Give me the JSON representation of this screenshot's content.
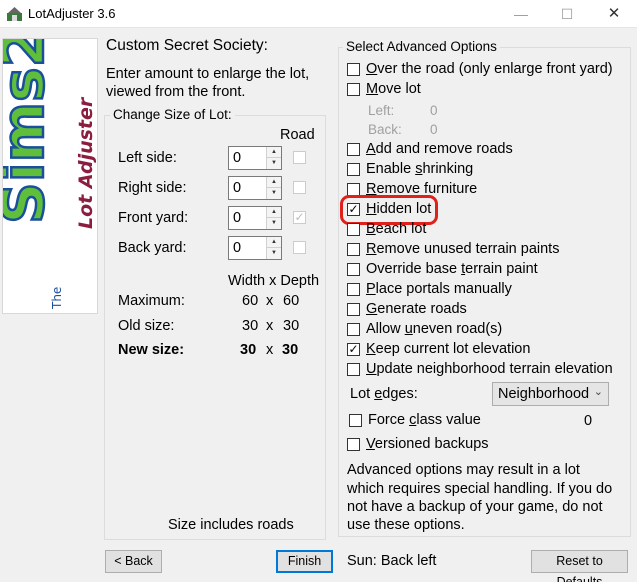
{
  "window": {
    "title": "LotAdjuster 3.6",
    "minimize": "—",
    "maximize": "☐",
    "close": "✕"
  },
  "logo": {
    "game": "The Sims 2",
    "product": "Lot Adjuster"
  },
  "lot": {
    "name": "Custom Secret Society:",
    "instructions_line1": "Enter amount to enlarge the lot,",
    "instructions_line2": "viewed from the front."
  },
  "size_group": {
    "title": "Change Size of Lot:",
    "road_header": "Road",
    "rows": [
      {
        "label": "Left side:",
        "value": "0",
        "road": false,
        "road_glyph": ""
      },
      {
        "label": "Right side:",
        "value": "0",
        "road": false,
        "road_glyph": ""
      },
      {
        "label": "Front yard:",
        "value": "0",
        "road": true,
        "road_glyph": "✓"
      },
      {
        "label": "Back yard:",
        "value": "0",
        "road": false,
        "road_glyph": ""
      }
    ],
    "dims_header": "Width x Depth",
    "x": "x",
    "maximum": {
      "label": "Maximum:",
      "w": "60",
      "d": "60"
    },
    "old_size": {
      "label": "Old size:",
      "w": "30",
      "d": "30"
    },
    "new_size": {
      "label": "New size:",
      "w": "30",
      "d": "30"
    },
    "note": "Size includes roads"
  },
  "advanced": {
    "title": "Select Advanced Options",
    "options": [
      {
        "u": "O",
        "rest": "ver the road (only enlarge front yard)",
        "checked": false,
        "glyph": ""
      },
      {
        "u": "M",
        "rest": "ove lot",
        "checked": false,
        "glyph": ""
      },
      {
        "u": "A",
        "rest": "dd and remove roads",
        "checked": false,
        "glyph": ""
      },
      {
        "pre": "Enable ",
        "u": "s",
        "rest": "hrinking",
        "checked": false,
        "glyph": ""
      },
      {
        "u": "R",
        "rest": "emove furniture",
        "checked": false,
        "glyph": ""
      },
      {
        "u": "H",
        "rest": "idden lot",
        "checked": true,
        "glyph": "✓"
      },
      {
        "u": "B",
        "rest": "each lot",
        "checked": false,
        "glyph": ""
      },
      {
        "u": "R",
        "rest": "emove unused terrain paints",
        "checked": false,
        "glyph": ""
      },
      {
        "pre": "Override base ",
        "u": "t",
        "rest": "errain paint",
        "checked": false,
        "glyph": ""
      },
      {
        "u": "P",
        "rest": "lace portals manually",
        "checked": false,
        "glyph": ""
      },
      {
        "u": "G",
        "rest": "enerate roads",
        "checked": false,
        "glyph": ""
      },
      {
        "pre": "Allow ",
        "u": "u",
        "rest": "neven road(s)",
        "checked": false,
        "glyph": ""
      },
      {
        "u": "K",
        "rest": "eep current lot elevation",
        "checked": true,
        "glyph": "✓"
      },
      {
        "u": "U",
        "rest": "pdate neighborhood terrain elevation",
        "checked": false,
        "glyph": ""
      }
    ],
    "move_left_label": "Left:",
    "move_left_value": "0",
    "move_back_label": "Back:",
    "move_back_value": "0",
    "lot_edges_pre": "Lot ",
    "lot_edges_u": "e",
    "lot_edges_rest": "dges:",
    "lot_edges_value": "Neighborhood",
    "force_pre": "Force ",
    "force_u": "c",
    "force_rest": "lass value",
    "force_value": "0",
    "versioned_u": "V",
    "versioned_rest": "ersioned backups",
    "warning": [
      "Advanced options may result in a lot",
      "which requires special handling.  If you do",
      "not have a backup of your game, do not",
      "use these options."
    ]
  },
  "footer": {
    "back": "< Back",
    "finish": "Finish",
    "sun": "Sun: Back left",
    "reset": "Reset to Defaults"
  },
  "colors": {
    "highlight": "#e0201b",
    "logo_green": "#5fbf3a",
    "logo_blue": "#1a4f9c"
  }
}
